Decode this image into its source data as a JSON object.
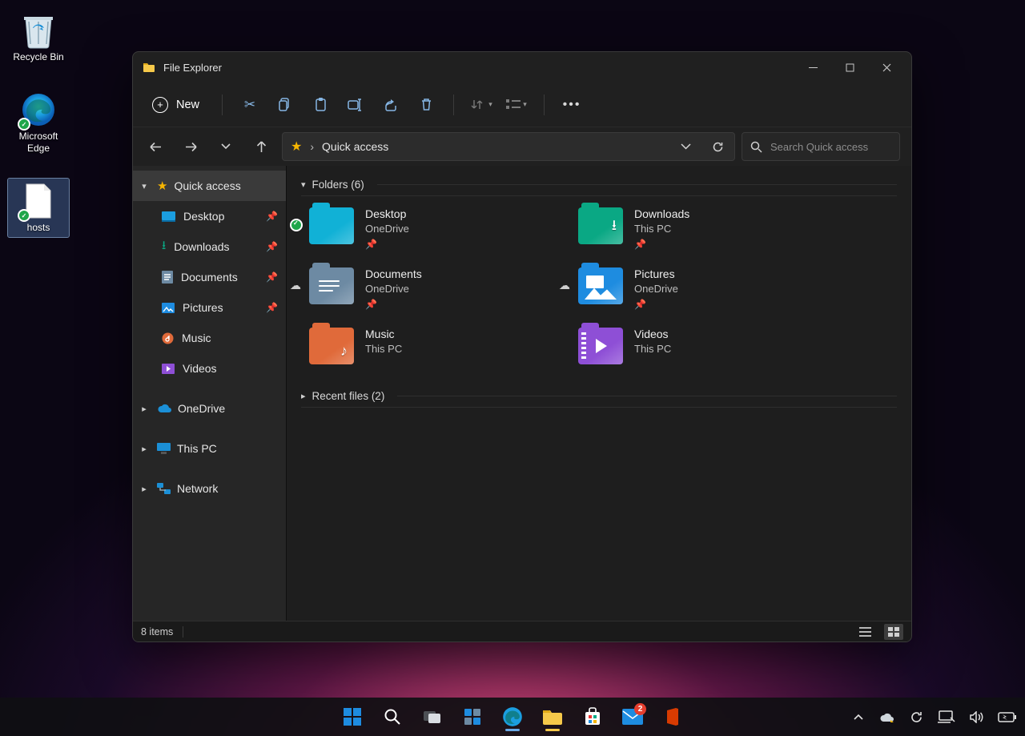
{
  "desktop_icons": [
    {
      "name": "recycle-bin",
      "label": "Recycle Bin"
    },
    {
      "name": "microsoft-edge",
      "label": "Microsoft Edge"
    },
    {
      "name": "hosts",
      "label": "hosts"
    }
  ],
  "window": {
    "title": "File Explorer",
    "new_label": "New",
    "address_location": "Quick access",
    "search_placeholder": "Search Quick access",
    "status_text": "8 items"
  },
  "sidebar": {
    "quick_access": {
      "label": "Quick access"
    },
    "items": [
      {
        "label": "Desktop",
        "pinned": true,
        "icon": "desktop"
      },
      {
        "label": "Downloads",
        "pinned": true,
        "icon": "downloads"
      },
      {
        "label": "Documents",
        "pinned": true,
        "icon": "documents"
      },
      {
        "label": "Pictures",
        "pinned": true,
        "icon": "pictures"
      },
      {
        "label": "Music",
        "pinned": false,
        "icon": "music"
      },
      {
        "label": "Videos",
        "pinned": false,
        "icon": "videos"
      }
    ],
    "roots": [
      {
        "label": "OneDrive",
        "icon": "onedrive"
      },
      {
        "label": "This PC",
        "icon": "thispc"
      },
      {
        "label": "Network",
        "icon": "network"
      }
    ]
  },
  "content": {
    "folders_header": "Folders (6)",
    "recent_header": "Recent files (2)",
    "folders": [
      {
        "name": "Desktop",
        "sub": "OneDrive",
        "color": "#11b1d6",
        "sync": true,
        "pinned": true,
        "icon": "desktop"
      },
      {
        "name": "Downloads",
        "sub": "This PC",
        "color": "#0aa884",
        "pinned": true,
        "icon": "downloads"
      },
      {
        "name": "Documents",
        "sub": "OneDrive",
        "color": "#6d8aa3",
        "cloud": true,
        "pinned": true,
        "icon": "documents"
      },
      {
        "name": "Pictures",
        "sub": "OneDrive",
        "color": "#1e8ce0",
        "cloud": true,
        "pinned": true,
        "icon": "pictures"
      },
      {
        "name": "Music",
        "sub": "This PC",
        "color": "#e06a3a",
        "icon": "music"
      },
      {
        "name": "Videos",
        "sub": "This PC",
        "color": "#8e4fd6",
        "icon": "videos"
      }
    ]
  },
  "taskbar": {
    "mail_badge": "2"
  }
}
